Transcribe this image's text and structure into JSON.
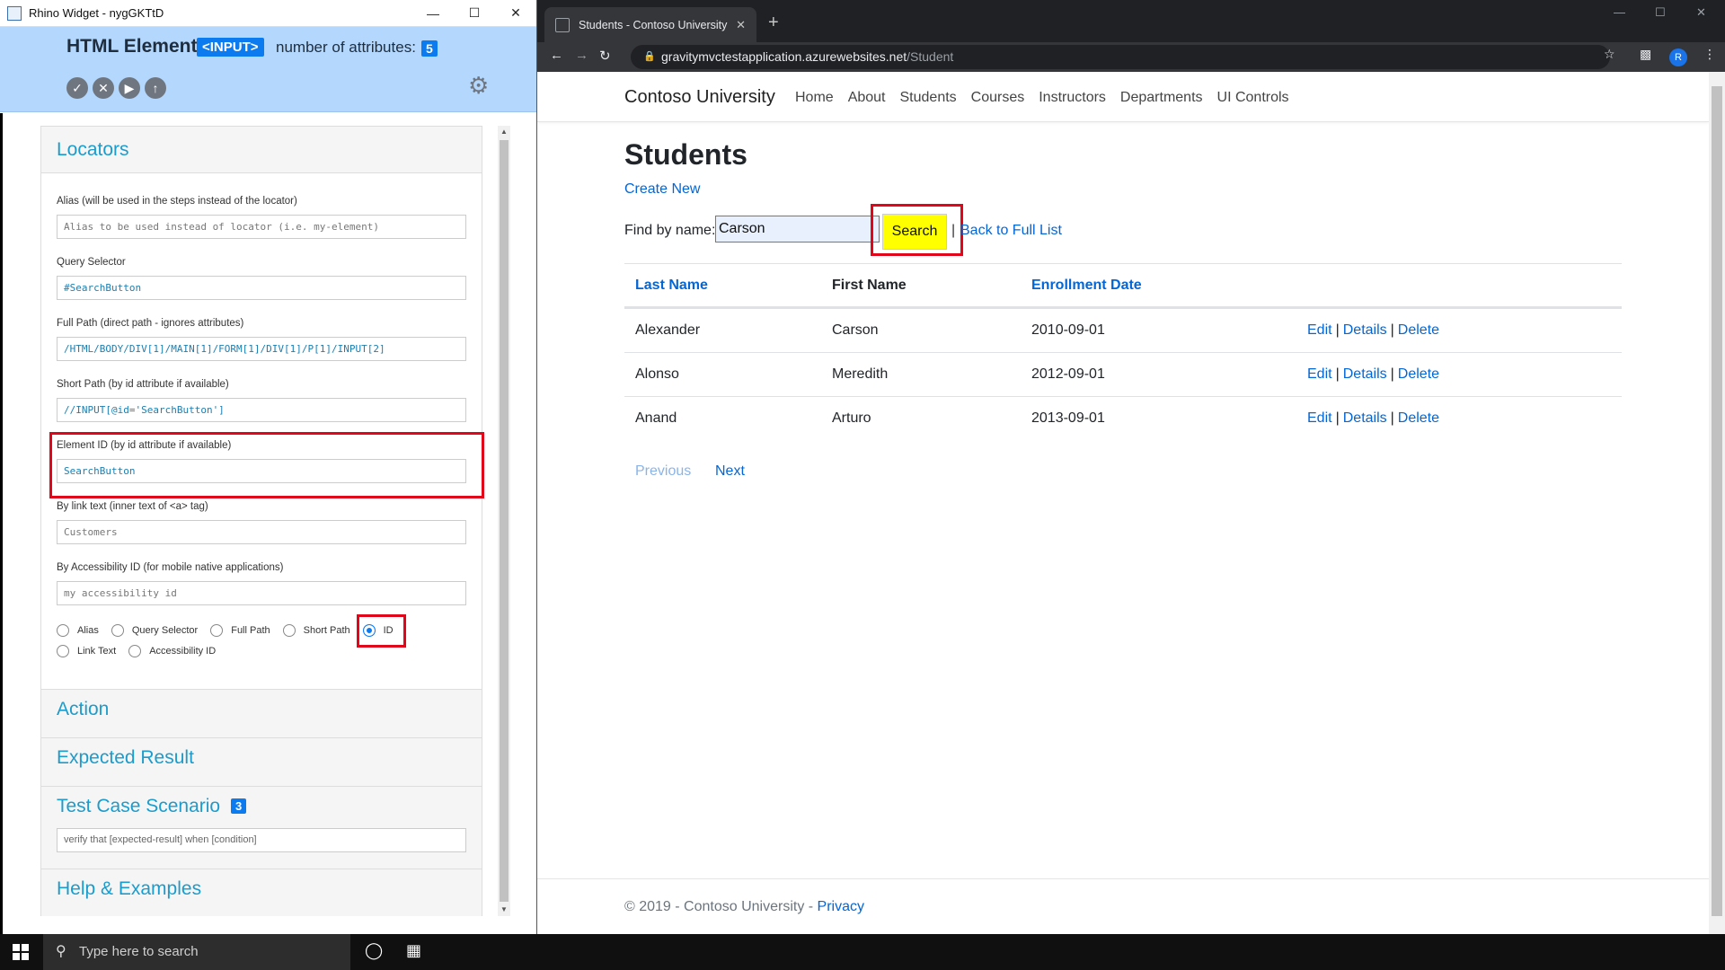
{
  "rhino": {
    "window_title": "Rhino Widget - nygGKTtD",
    "header": {
      "title": "HTML Element",
      "tag_badge": "<INPUT>",
      "attr_label": "number of attributes:",
      "attr_count": "5"
    },
    "locators": {
      "title": "Locators",
      "fields": [
        {
          "label": "Alias (will be used in the steps instead of the locator)",
          "value": "",
          "placeholder": "Alias to be used instead of locator (i.e. my-element)"
        },
        {
          "label": "Query Selector",
          "value": "#SearchButton",
          "placeholder": ""
        },
        {
          "label": "Full Path (direct path - ignores attributes)",
          "value": "/HTML/BODY/DIV[1]/MAIN[1]/FORM[1]/DIV[1]/P[1]/INPUT[2]",
          "placeholder": ""
        },
        {
          "label": "Short Path (by id attribute if available)",
          "value": "//INPUT[@id='SearchButton']",
          "placeholder": ""
        },
        {
          "label": "Element ID (by id attribute if available)",
          "value": "SearchButton",
          "placeholder": ""
        },
        {
          "label": "By link text (inner text of <a> tag)",
          "value": "",
          "placeholder": "Customers"
        },
        {
          "label": "By Accessibility ID (for mobile native applications)",
          "value": "",
          "placeholder": "my accessibility id"
        }
      ],
      "radios_row1": [
        "Alias",
        "Query Selector",
        "Full Path",
        "Short Path",
        "ID"
      ],
      "radios_row2": [
        "Link Text",
        "Accessibility ID"
      ],
      "selected_radio": "ID"
    },
    "sections": {
      "action": "Action",
      "expected": "Expected Result",
      "scenario": "Test Case Scenario",
      "scenario_count": "3",
      "scenario_value": "verify that [expected-result] when [condition]",
      "help": "Help & Examples"
    }
  },
  "browser": {
    "tab_title": "Students - Contoso University",
    "url_host": "gravitymvctestapplication.azurewebsites.net",
    "url_path": "/Student",
    "avatar_letter": "R"
  },
  "site": {
    "brand": "Contoso University",
    "nav": [
      "Home",
      "About",
      "Students",
      "Courses",
      "Instructors",
      "Departments",
      "UI Controls"
    ],
    "heading": "Students",
    "create_new": "Create New",
    "find_label": "Find by name:",
    "search_value": "Carson",
    "search_button": "Search",
    "separator": "|",
    "back_link": "Back to Full List",
    "columns": [
      "Last Name",
      "First Name",
      "Enrollment Date"
    ],
    "rows": [
      {
        "last": "Alexander",
        "first": "Carson",
        "date": "2010-09-01"
      },
      {
        "last": "Alonso",
        "first": "Meredith",
        "date": "2012-09-01"
      },
      {
        "last": "Anand",
        "first": "Arturo",
        "date": "2013-09-01"
      }
    ],
    "row_actions": [
      "Edit",
      "Details",
      "Delete"
    ],
    "pager": {
      "previous": "Previous",
      "next": "Next"
    },
    "footer_text": "© 2019 - Contoso University - ",
    "footer_link": "Privacy"
  },
  "taskbar": {
    "search_placeholder": "Type here to search"
  },
  "icons": {
    "tools": [
      "check-icon",
      "close-icon",
      "play-icon",
      "upload-icon"
    ],
    "settings": "gears-icon"
  },
  "colors": {
    "header_bg": "#b3d7fd",
    "accent_blue": "#0d7bf0",
    "section_teal": "#1b9ccc",
    "highlight_red": "#e1061a",
    "search_yellow": "#ffff00",
    "link_blue": "#0366d6"
  }
}
